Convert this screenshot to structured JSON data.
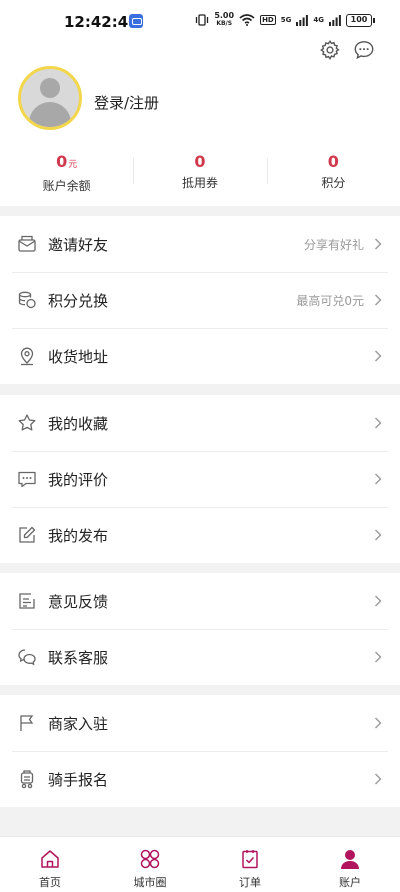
{
  "status_bar": {
    "time": "12:42:40",
    "net_speed_value": "5.00",
    "net_speed_unit": "KB/S",
    "hd_label": "HD",
    "sig1_label": "5G",
    "sig2_label": "4G",
    "battery": "100"
  },
  "header": {
    "login_label": "登录/注册",
    "stats": [
      {
        "value": "0",
        "unit": "元",
        "label": "账户余额"
      },
      {
        "value": "0",
        "label": "抵用券"
      },
      {
        "value": "0",
        "label": "积分"
      }
    ]
  },
  "menu": {
    "invite": {
      "label": "邀请好友",
      "hint": "分享有好礼"
    },
    "points": {
      "label": "积分兑换",
      "hint": "最高可兑0元"
    },
    "address": {
      "label": "收货地址"
    },
    "favorites": {
      "label": "我的收藏"
    },
    "reviews": {
      "label": "我的评价"
    },
    "posts": {
      "label": "我的发布"
    },
    "feedback": {
      "label": "意见反馈"
    },
    "service": {
      "label": "联系客服"
    },
    "merchant": {
      "label": "商家入驻"
    },
    "rider": {
      "label": "骑手报名"
    }
  },
  "tabbar": {
    "home": "首页",
    "circle": "城市圈",
    "orders": "订单",
    "account": "账户"
  },
  "colors": {
    "accent": "#d1394e",
    "tab_active": "#b0155e",
    "avatar_ring": "#f2d64b"
  }
}
